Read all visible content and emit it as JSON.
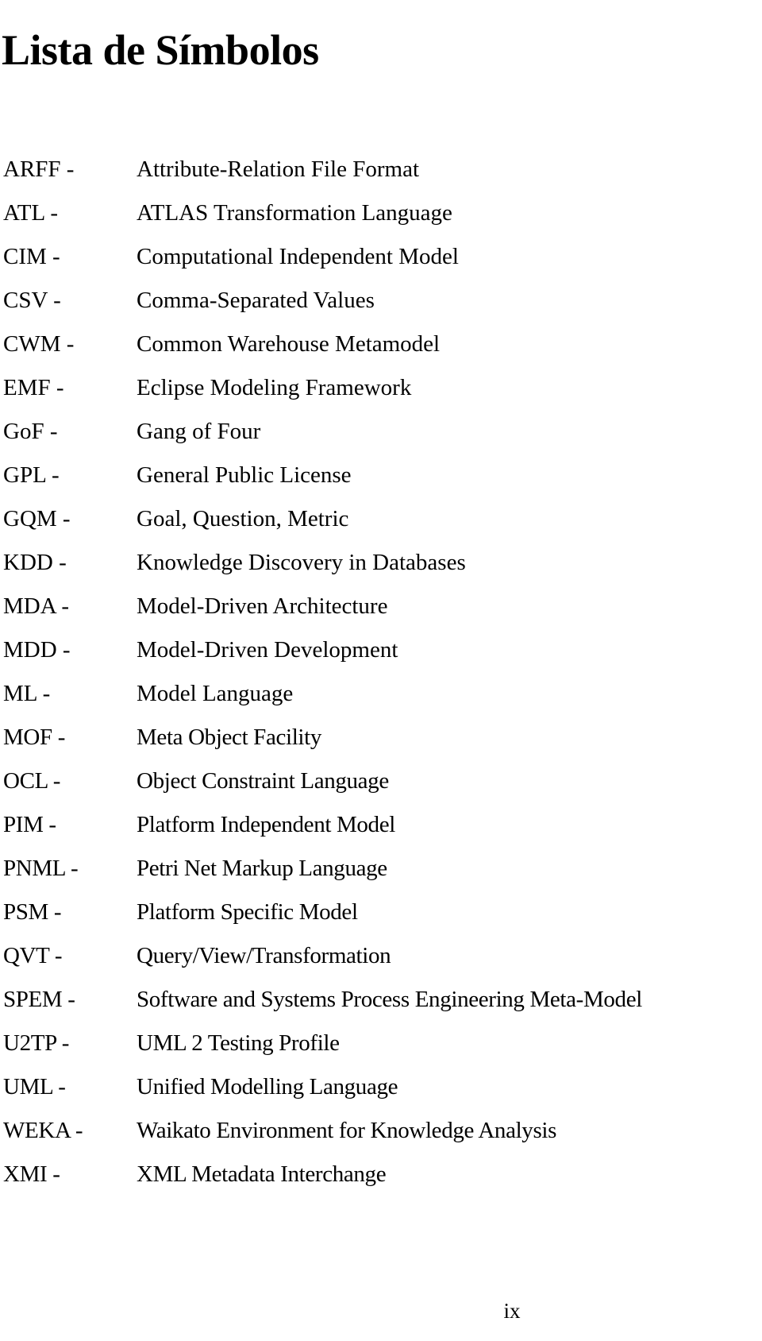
{
  "document": {
    "title": "Lista de Símbolos",
    "page_number": "ix"
  },
  "symbols": [
    {
      "abbr": "ARFF -",
      "desc": "Attribute-Relation File Format"
    },
    {
      "abbr": "ATL -",
      "desc": "ATLAS Transformation Language"
    },
    {
      "abbr": "CIM -",
      "desc": "Computational Independent Model"
    },
    {
      "abbr": "CSV -",
      "desc": "Comma-Separated Values"
    },
    {
      "abbr": "CWM -",
      "desc": "Common Warehouse Metamodel"
    },
    {
      "abbr": "EMF -",
      "desc": "Eclipse Modeling Framework"
    },
    {
      "abbr": "GoF -",
      "desc": "Gang of Four"
    },
    {
      "abbr": "GPL -",
      "desc": "General Public License"
    },
    {
      "abbr": "GQM -",
      "desc": "Goal, Question, Metric"
    },
    {
      "abbr": "KDD -",
      "desc": "Knowledge Discovery in Databases"
    },
    {
      "abbr": "MDA -",
      "desc": "Model-Driven Architecture"
    },
    {
      "abbr": "MDD -",
      "desc": "Model-Driven Development"
    },
    {
      "abbr": "ML -",
      "desc": "Model Language"
    },
    {
      "abbr": "MOF -",
      "desc": "Meta Object Facility"
    },
    {
      "abbr": "OCL -",
      "desc": "Object Constraint Language"
    },
    {
      "abbr": "PIM -",
      "desc": "Platform Independent Model"
    },
    {
      "abbr": "PNML -",
      "desc": "Petri Net Markup Language"
    },
    {
      "abbr": "PSM -",
      "desc": "Platform Specific Model"
    },
    {
      "abbr": "QVT -",
      "desc": "Query/View/Transformation"
    },
    {
      "abbr": "SPEM -",
      "desc": "Software and Systems Process Engineering Meta-Model"
    },
    {
      "abbr": "U2TP -",
      "desc": "UML 2 Testing Profile"
    },
    {
      "abbr": "UML -",
      "desc": "Unified Modelling Language"
    },
    {
      "abbr": "WEKA -",
      "desc": "Waikato Environment for Knowledge Analysis"
    },
    {
      "abbr": "XMI -",
      "desc": "XML Metadata Interchange"
    }
  ]
}
